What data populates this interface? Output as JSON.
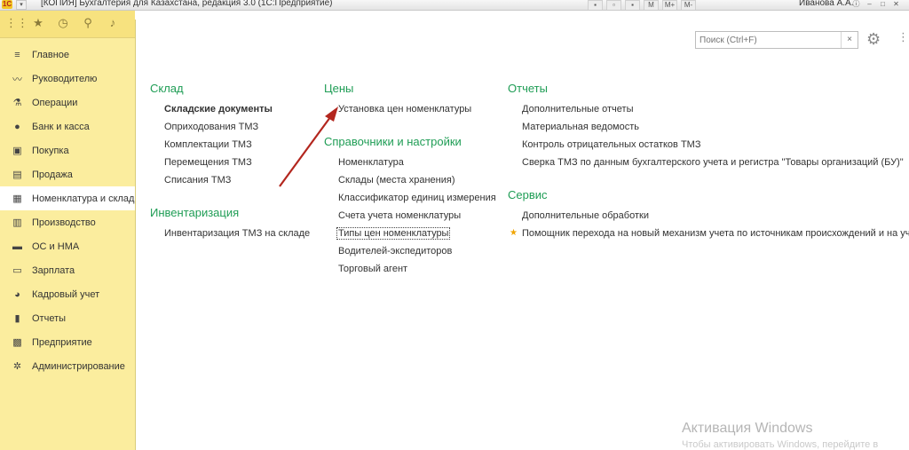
{
  "window": {
    "title": "[КОПИЯ] Бухгалтерия для Казахстана, редакция 3.0  (1С:Предприятие)",
    "logo": "1С",
    "user": "Иванова А.А.",
    "tools": [
      "M",
      "M+",
      "M-"
    ]
  },
  "sidebar": {
    "top_icons": [
      "apps-grid-icon",
      "star-icon",
      "history-icon",
      "search-icon",
      "bell-icon"
    ],
    "items": [
      {
        "label": "Главное",
        "icon": "≡"
      },
      {
        "label": "Руководителю",
        "icon": "〰"
      },
      {
        "label": "Операции",
        "icon": "⚗"
      },
      {
        "label": "Банк и касса",
        "icon": "●"
      },
      {
        "label": "Покупка",
        "icon": "▣"
      },
      {
        "label": "Продажа",
        "icon": "▤"
      },
      {
        "label": "Номенклатура и склад",
        "icon": "▦",
        "active": true
      },
      {
        "label": "Производство",
        "icon": "▥"
      },
      {
        "label": "ОС и НМА",
        "icon": "▬"
      },
      {
        "label": "Зарплата",
        "icon": "▭"
      },
      {
        "label": "Кадровый учет",
        "icon": "◕"
      },
      {
        "label": "Отчеты",
        "icon": "▮"
      },
      {
        "label": "Предприятие",
        "icon": "▩"
      },
      {
        "label": "Администрирование",
        "icon": "✲"
      }
    ]
  },
  "search": {
    "placeholder": "Поиск (Ctrl+F)",
    "clear": "×"
  },
  "sections": {
    "sklad": {
      "title": "Склад",
      "links": [
        "Складские документы",
        "Оприходования ТМЗ",
        "Комплектации ТМЗ",
        "Перемещения ТМЗ",
        "Списания ТМЗ"
      ]
    },
    "inventory": {
      "title": "Инвентаризация",
      "links": [
        "Инвентаризация ТМЗ на складе"
      ]
    },
    "prices": {
      "title": "Цены",
      "links": [
        "Установка цен номенклатуры"
      ]
    },
    "refs": {
      "title": "Справочники и настройки",
      "links": [
        "Номенклатура",
        "Склады (места хранения)",
        "Классификатор единиц измерения",
        "Счета учета номенклатуры",
        "Типы цен номенклатуры",
        "Водителей-экспедиторов",
        "Торговый агент"
      ]
    },
    "reports": {
      "title": "Отчеты",
      "links": [
        "Дополнительные отчеты",
        "Материальная ведомость",
        "Контроль отрицательных остатков ТМЗ",
        "Сверка ТМЗ по данным бухгалтерского учета и регистра \"Товары организаций (БУ)\""
      ]
    },
    "service": {
      "title": "Сервис",
      "links": [
        "Дополнительные обработки",
        "Помощник перехода на новый механизм учета по источникам происхождений и на учет товар"
      ]
    }
  },
  "watermark": {
    "title": "Активация Windows",
    "subtitle": "Чтобы активировать Windows, перейдите в"
  },
  "colors": {
    "sidebar": "#fbed9e",
    "section_title": "#1f9d55",
    "arrow": "#b3261e"
  }
}
